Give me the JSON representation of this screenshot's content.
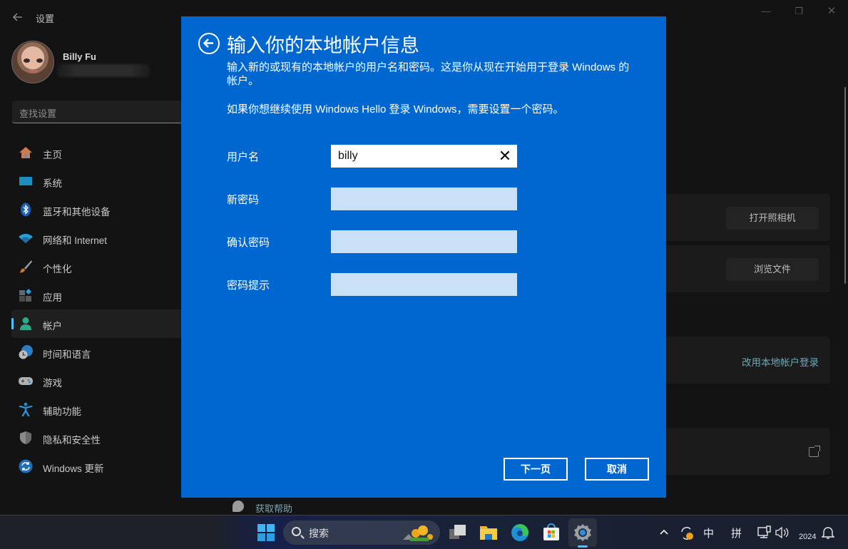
{
  "window": {
    "title": "设置",
    "controls": {
      "minimize": "—",
      "restore": "❐",
      "close": "✕"
    }
  },
  "profile": {
    "name": "Billy Fu",
    "email_redacted": true
  },
  "search": {
    "placeholder": "查找设置"
  },
  "sidebar": {
    "items": [
      {
        "label": "主页",
        "icon": "home-icon",
        "active": false
      },
      {
        "label": "系统",
        "icon": "system-icon",
        "active": false
      },
      {
        "label": "蓝牙和其他设备",
        "icon": "bluetooth-icon",
        "active": false
      },
      {
        "label": "网络和 Internet",
        "icon": "wifi-icon",
        "active": false
      },
      {
        "label": "个性化",
        "icon": "brush-icon",
        "active": false
      },
      {
        "label": "应用",
        "icon": "apps-icon",
        "active": false
      },
      {
        "label": "帐户",
        "icon": "account-icon",
        "active": true
      },
      {
        "label": "时间和语言",
        "icon": "time-language-icon",
        "active": false
      },
      {
        "label": "游戏",
        "icon": "gamepad-icon",
        "active": false
      },
      {
        "label": "辅助功能",
        "icon": "accessibility-icon",
        "active": false
      },
      {
        "label": "隐私和安全性",
        "icon": "shield-icon",
        "active": false
      },
      {
        "label": "Windows 更新",
        "icon": "update-icon",
        "active": false
      }
    ]
  },
  "content": {
    "open_camera": "打开照相机",
    "browse_files": "浏览文件",
    "switch_local": "改用本地帐户登录",
    "get_help": "获取帮助"
  },
  "dialog": {
    "title": "输入你的本地帐户信息",
    "description": "输入新的或现有的本地帐户的用户名和密码。这是你从现在开始用于登录 Windows 的帐户。",
    "hello_note": "如果你想继续使用 Windows Hello 登录 Windows，需要设置一个密码。",
    "fields": [
      {
        "label": "用户名",
        "value": "billy"
      },
      {
        "label": "新密码",
        "value": ""
      },
      {
        "label": "确认密码",
        "value": ""
      },
      {
        "label": "密码提示",
        "value": ""
      }
    ],
    "next": "下一页",
    "cancel": "取消",
    "accent": "#0067d1"
  },
  "taskbar": {
    "search_placeholder": "搜索",
    "ime_mode": "中",
    "ime_type": "拼",
    "clock": "2024"
  }
}
